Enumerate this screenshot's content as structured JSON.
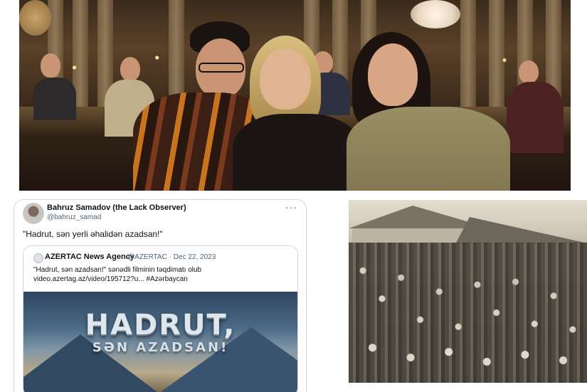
{
  "tweet": {
    "author_name": "Bahruz Samadov (the Lack Observer)",
    "author_handle": "@bahruz_samad",
    "more_label": "···",
    "text": "\"Hadrut, sən yerli əhalidən azadsan!\"",
    "quote": {
      "author_name": "AZERTAC News Agency",
      "meta": "@AZERTAC · Dec 22, 2023",
      "line1": "\"Hadrut, sən azadsan!\" sənədli filminin təqdimatı olub",
      "line2": "video.azertag.az/video/195712?u... #Azərbaycan",
      "image_title": "HADRUT,",
      "image_subtitle": "SƏN AZADSAN!"
    }
  },
  "icons": {
    "avatar": "user-avatar-icon",
    "quote_logo": "azertac-logo-icon",
    "more": "more-options-icon"
  },
  "colors": {
    "text_primary": "#0f1419",
    "text_secondary": "#536471",
    "card_border": "#cfd9de"
  }
}
